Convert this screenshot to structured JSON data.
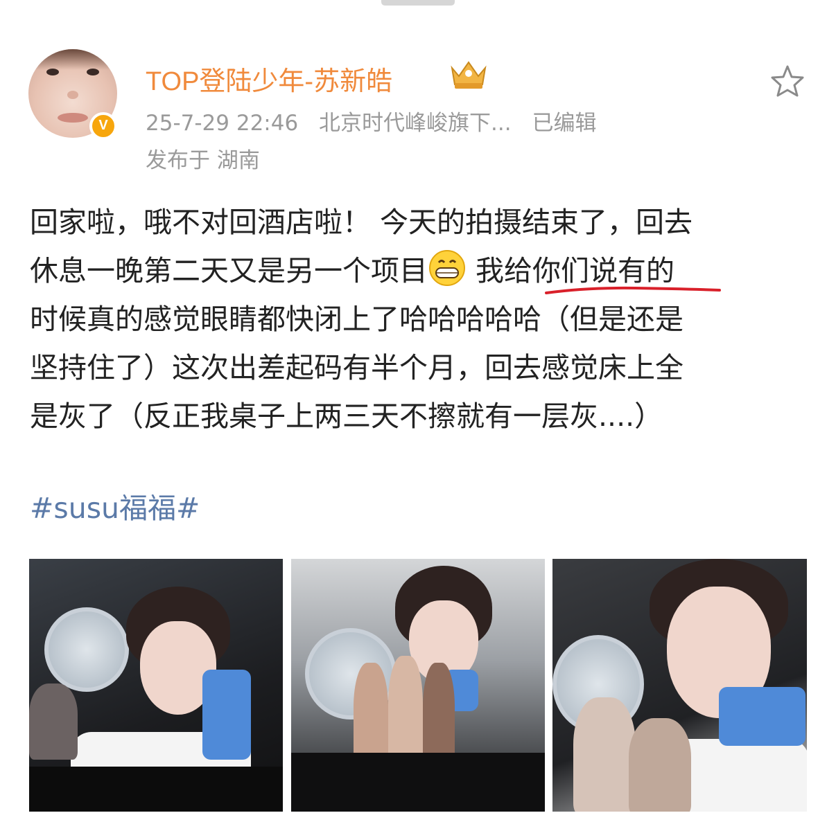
{
  "post": {
    "username": "TOP登陆少年-苏新皓",
    "timestamp": "25-7-29 22:46",
    "source": "北京时代峰峻旗下...",
    "edited": "已编辑",
    "location": "发布于 湖南",
    "text_lines": [
      "回家啦，哦不对回酒店啦！ 今天的拍摄结束了，回去",
      "休息一晚第二天又是另一个项目",
      "我给你们说有的",
      "时候真的感觉眼睛都快闭上了哈哈哈哈哈（但是还是",
      "坚持住了）这次出差起码有半个月，回去感觉床上全",
      "是灰了（反正我桌子上两三天不擦就有一层灰....）"
    ],
    "hashtag": "#susu福福#",
    "verified_badge": "V"
  },
  "icons": {
    "verified": "verified-v-icon",
    "crown": "crown-icon",
    "favorite": "star-icon",
    "emoji": "grin-icon"
  },
  "colors": {
    "username": "#f08a3c",
    "meta": "#9a9a9a",
    "hashtag": "#5b7aa8",
    "annotation": "#d9202a",
    "badge": "#f7a60d"
  }
}
